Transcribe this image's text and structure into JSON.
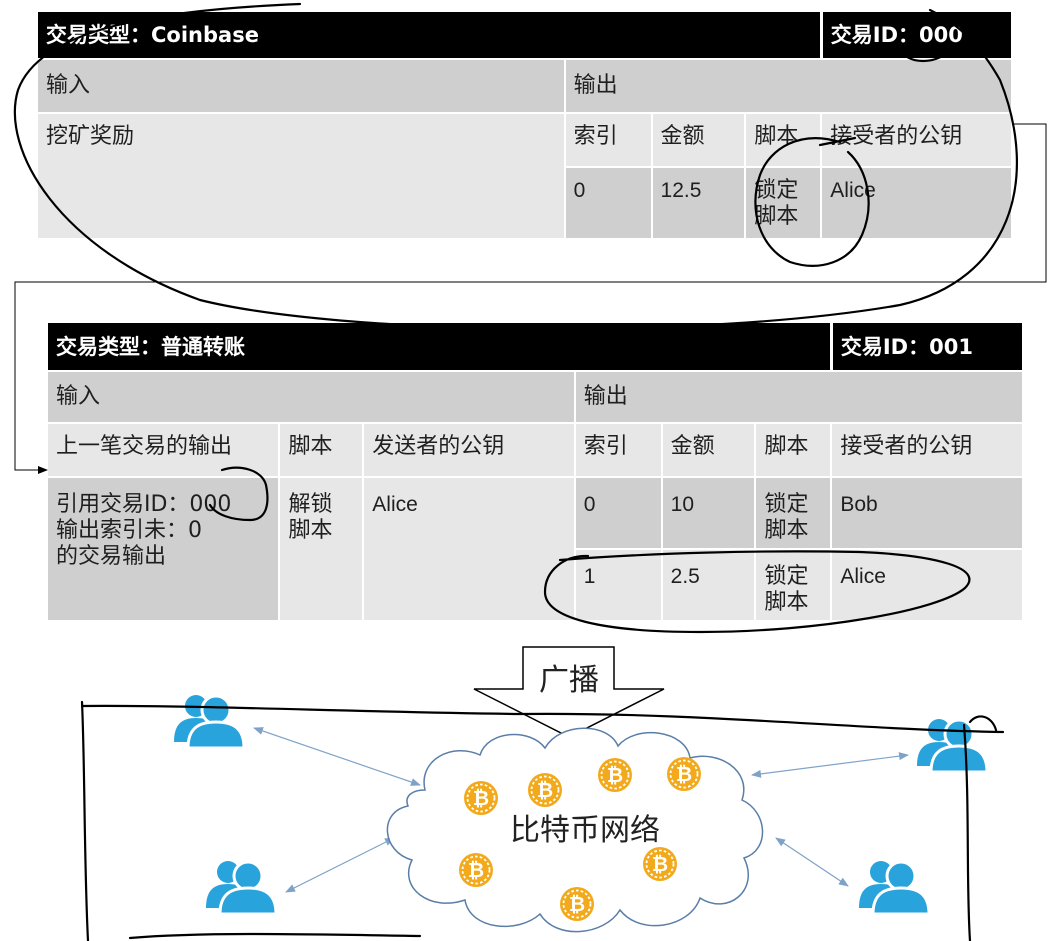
{
  "tx0": {
    "type_label": "交易类型：Coinbase",
    "id_label": "交易ID：000",
    "input_header": "输入",
    "output_header": "输出",
    "input_desc": "挖矿奖励",
    "col_index": "索引",
    "col_amount": "金额",
    "col_script": "脚本",
    "col_pubkey": "接受者的公钥",
    "outputs": [
      {
        "index": "0",
        "amount": "12.5",
        "script": "锁定\n脚本",
        "pubkey": "Alice"
      }
    ]
  },
  "tx1": {
    "type_label": "交易类型：普通转账",
    "id_label": "交易ID：001",
    "input_header": "输入",
    "output_header": "输出",
    "col_prev_output": "上一笔交易的输出",
    "col_in_script": "脚本",
    "col_sender_pubkey": "发送者的公钥",
    "col_index": "索引",
    "col_amount": "金额",
    "col_out_script": "脚本",
    "col_pubkey": "接受者的公钥",
    "input_ref": "引用交易ID：000\n输出索引未：0\n的交易输出",
    "input_script": "解锁\n脚本",
    "input_sender": "Alice",
    "outputs": [
      {
        "index": "0",
        "amount": "10",
        "script": "锁定\n脚本",
        "pubkey": "Bob"
      },
      {
        "index": "1",
        "amount": "2.5",
        "script": "锁定\n脚本",
        "pubkey": "Alice"
      }
    ]
  },
  "broadcast_label": "广播",
  "network_label": "比特币网络",
  "coin_symbol": "₿",
  "colors": {
    "user_icon": "#29a3dc",
    "coin": "#f2a91b",
    "cloud_stroke": "#5a7ea8",
    "link": "#7fa3c8"
  }
}
